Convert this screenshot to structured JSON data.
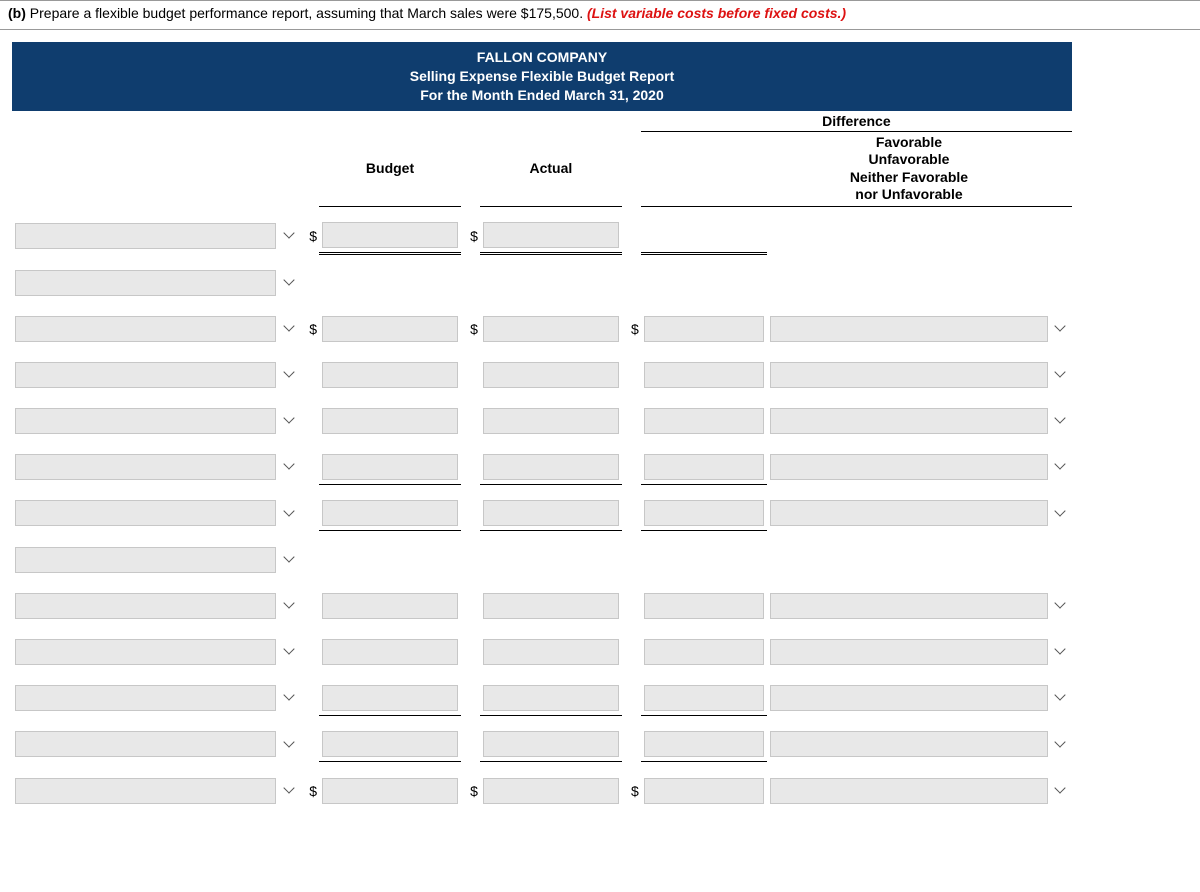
{
  "prompt": {
    "label": "(b)",
    "text": "Prepare a flexible budget performance report, assuming that March sales were $175,500.",
    "hint": "(List variable costs before fixed costs.)"
  },
  "report_header": {
    "company": "FALLON COMPANY",
    "title": "Selling Expense Flexible Budget Report",
    "period": "For the Month Ended March 31, 2020"
  },
  "columns": {
    "budget": "Budget",
    "actual": "Actual",
    "difference": "Difference",
    "favorable_lines": [
      "Favorable",
      "Unfavorable",
      "Neither Favorable",
      "nor Unfavorable"
    ]
  },
  "currency": "$",
  "rows": [
    {
      "desc": "",
      "dd": true,
      "dollar": true,
      "budget": "",
      "actual": "",
      "diff": null,
      "fav": null,
      "favdd": false,
      "under": "dbl"
    },
    {
      "desc": "",
      "dd": true,
      "dollar": false,
      "budget": null,
      "actual": null,
      "diff": null,
      "fav": null,
      "favdd": false,
      "under": ""
    },
    {
      "desc": "",
      "dd": true,
      "dollar": true,
      "budget": "",
      "actual": "",
      "diff": "",
      "fav": "",
      "favdd": true,
      "under": ""
    },
    {
      "desc": "",
      "dd": true,
      "dollar": false,
      "budget": "",
      "actual": "",
      "diff": "",
      "fav": "",
      "favdd": true,
      "under": ""
    },
    {
      "desc": "",
      "dd": true,
      "dollar": false,
      "budget": "",
      "actual": "",
      "diff": "",
      "fav": "",
      "favdd": true,
      "under": ""
    },
    {
      "desc": "",
      "dd": true,
      "dollar": false,
      "budget": "",
      "actual": "",
      "diff": "",
      "fav": "",
      "favdd": true,
      "under": "single"
    },
    {
      "desc": "",
      "dd": true,
      "dollar": false,
      "budget": "",
      "actual": "",
      "diff": "",
      "fav": "",
      "favdd": true,
      "under": "single"
    },
    {
      "desc": "",
      "dd": true,
      "dollar": false,
      "budget": null,
      "actual": null,
      "diff": null,
      "fav": null,
      "favdd": false,
      "under": ""
    },
    {
      "desc": "",
      "dd": true,
      "dollar": false,
      "budget": "",
      "actual": "",
      "diff": "",
      "fav": "",
      "favdd": true,
      "under": ""
    },
    {
      "desc": "",
      "dd": true,
      "dollar": false,
      "budget": "",
      "actual": "",
      "diff": "",
      "fav": "",
      "favdd": true,
      "under": ""
    },
    {
      "desc": "",
      "dd": true,
      "dollar": false,
      "budget": "",
      "actual": "",
      "diff": "",
      "fav": "",
      "favdd": true,
      "under": "single"
    },
    {
      "desc": "",
      "dd": true,
      "dollar": false,
      "budget": "",
      "actual": "",
      "diff": "",
      "fav": "",
      "favdd": true,
      "under": "single"
    },
    {
      "desc": "",
      "dd": true,
      "dollar": true,
      "budget": "",
      "actual": "",
      "diff": "",
      "fav": "",
      "favdd": true,
      "under": ""
    }
  ]
}
